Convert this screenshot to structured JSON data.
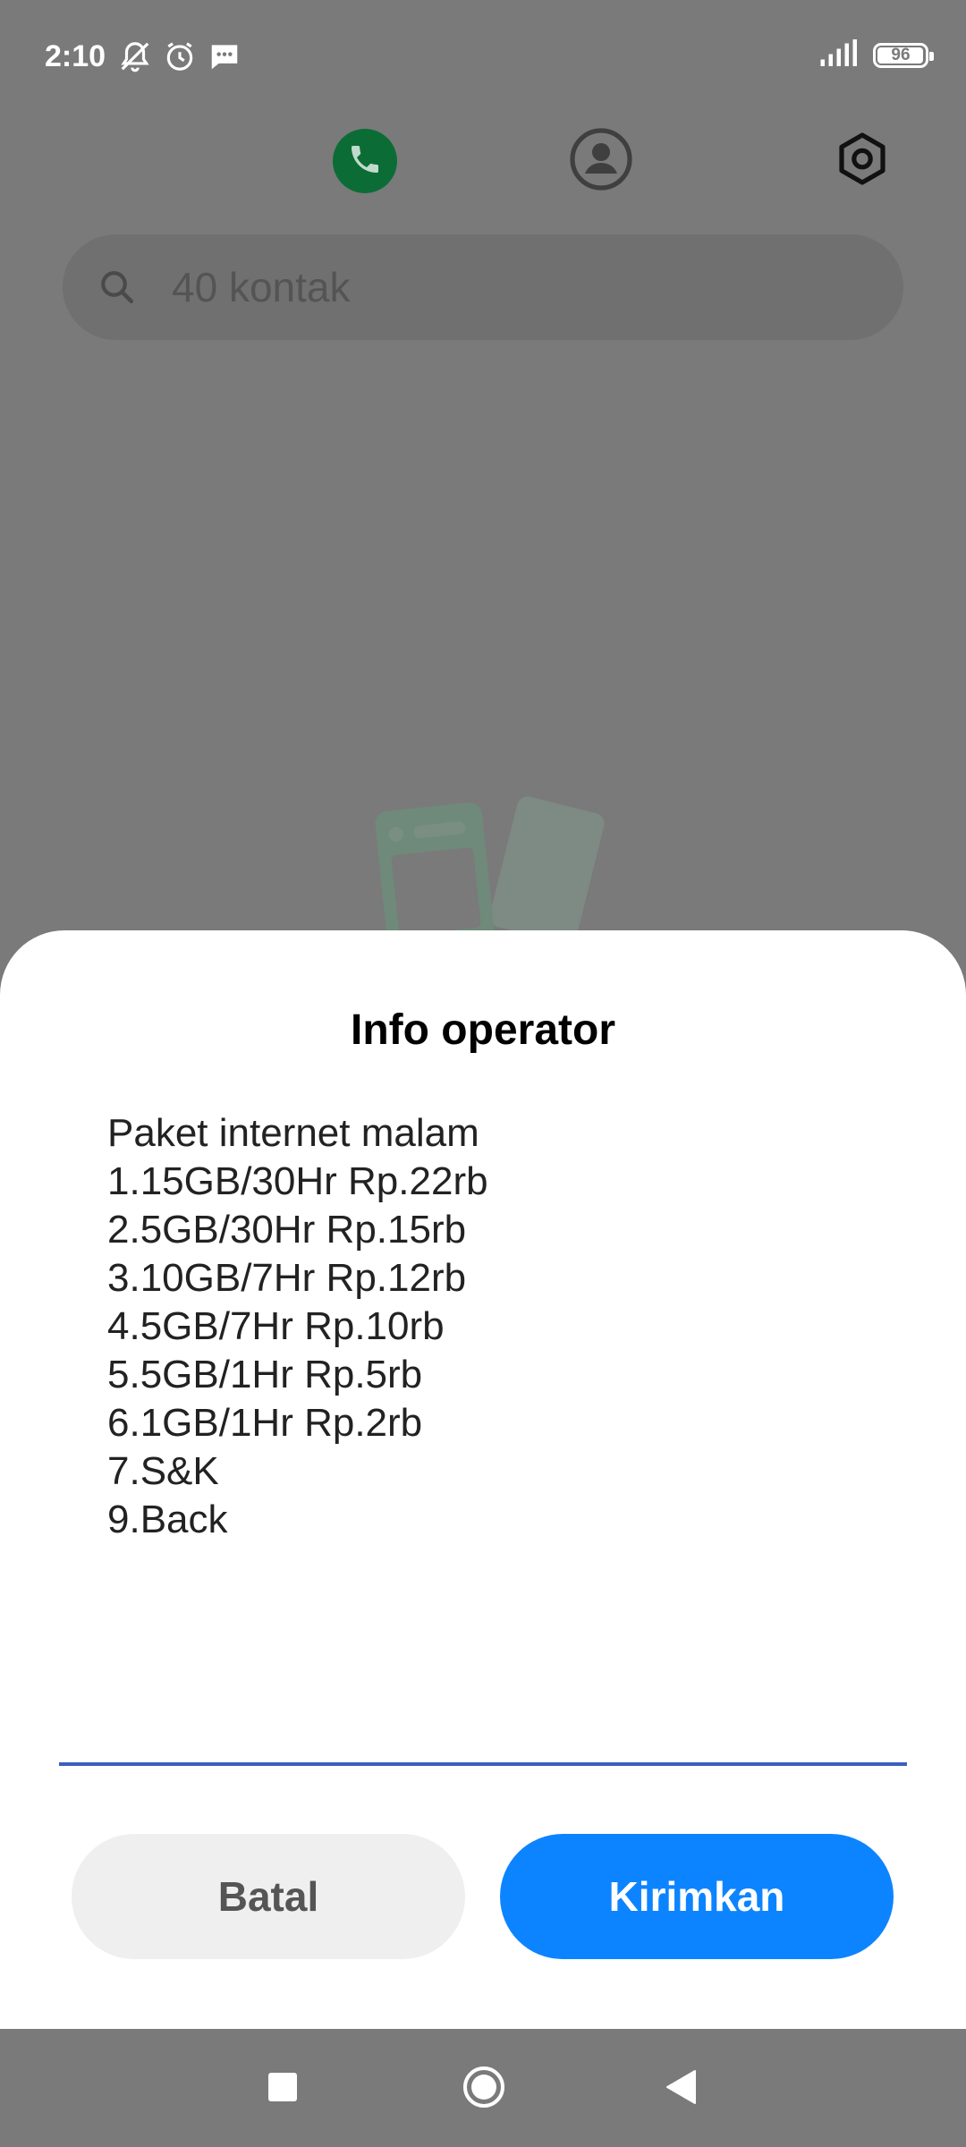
{
  "status_bar": {
    "time": "2:10",
    "battery_level": "96",
    "icons": [
      "notifications-muted-icon",
      "alarm-icon",
      "message-icon",
      "signal-icon",
      "battery-icon"
    ]
  },
  "tabs": [
    {
      "name": "dialer",
      "icon": "phone-icon",
      "active": true
    },
    {
      "name": "contacts",
      "icon": "person-icon",
      "active": false
    },
    {
      "name": "settings",
      "icon": "gear-icon",
      "active": false
    }
  ],
  "search": {
    "text": "40 kontak",
    "icon": "search-icon"
  },
  "dialog": {
    "title": "Info operator",
    "lines": [
      "Paket internet malam",
      "1.15GB/30Hr Rp.22rb",
      "2.5GB/30Hr Rp.15rb",
      "3.10GB/7Hr Rp.12rb",
      "4.5GB/7Hr Rp.10rb",
      "5.5GB/1Hr Rp.5rb",
      "6.1GB/1Hr Rp.2rb",
      "7.S&K",
      "9.Back"
    ],
    "input_value": "",
    "cancel_label": "Batal",
    "send_label": "Kirimkan"
  },
  "colors": {
    "accent": "#0d84ff",
    "input_underline": "#3b5fc0",
    "dialer_active": "#0b6d35",
    "scrim": "#7a7a7a"
  },
  "nav_bar": {
    "icons": [
      "recents-icon",
      "home-icon",
      "back-icon"
    ]
  }
}
